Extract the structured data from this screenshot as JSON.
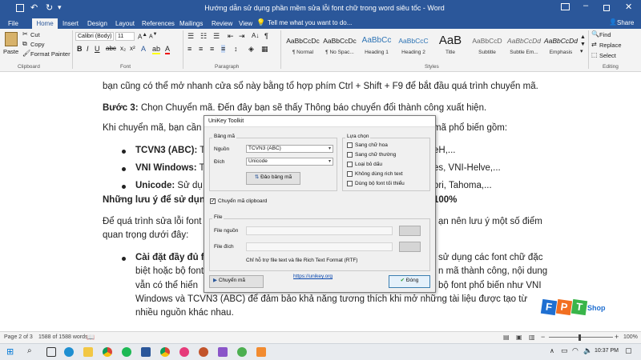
{
  "window": {
    "title": "Hướng dẫn sử dụng phần mềm sửa lỗi font chữ trong word siêu tốc - Word",
    "search_placeholder": "Tell me what you want to do..."
  },
  "tabs": [
    "File",
    "Home",
    "Insert",
    "Design",
    "Layout",
    "References",
    "Mailings",
    "Review",
    "View"
  ],
  "active_tab": "Home",
  "share_label": "Share",
  "ribbon": {
    "clipboard": {
      "paste": "Paste",
      "cut": "Cut",
      "copy": "Copy",
      "format_painter": "Format Painter",
      "label": "Clipboard"
    },
    "font": {
      "name": "Calibri (Body)",
      "size": "11",
      "label": "Font"
    },
    "paragraph_label": "Paragraph",
    "styles": [
      {
        "sample": "AaBbCcDc",
        "name": "¶ Normal"
      },
      {
        "sample": "AaBbCcDc",
        "name": "¶ No Spac..."
      },
      {
        "sample": "AaBbCc",
        "name": "Heading 1"
      },
      {
        "sample": "AaBbCcC",
        "name": "Heading 2"
      },
      {
        "sample": "AaB",
        "name": "Title"
      },
      {
        "sample": "AaBbCcD",
        "name": "Subtitle"
      },
      {
        "sample": "AaBbCcDd",
        "name": "Subtle Em..."
      },
      {
        "sample": "AaBbCcDd",
        "name": "Emphasis"
      }
    ],
    "styles_label": "Styles",
    "editing": {
      "find": "Find",
      "replace": "Replace",
      "select": "Select",
      "label": "Editing"
    }
  },
  "document": {
    "line_top": "bạn cũng có thể mở nhanh cửa sổ này bằng tổ hợp phím Ctrl + Shift + F9 để bắt đầu quá trình chuyển mã.",
    "step3_bold": "Bước 3:",
    "step3_text": " Chọn Chuyển mã. Đến đây bạn sẽ thấy Thông báo chuyển đổi thành công xuất hiện.",
    "para2_left": "Khi chuyển mã, bạn cần",
    "para2_right": "mã phổ biến gồm:",
    "bullets": [
      {
        "bold": "TCVN3 (ABC):",
        "left": " Th",
        "right": "eH,..."
      },
      {
        "bold": "VNI Windows:",
        "left": " T",
        "right": "es, VNI-Helve,..."
      },
      {
        "bold": "Unicode:",
        "left": " Sử dụ",
        "right": "ori, Tahoma,..."
      }
    ],
    "heading_left": "Những lưu ý để sử dụng",
    "heading_right": "100%",
    "para3_l1_left": "Để quá trình sửa lỗi font",
    "para3_l1_right": "ạn nên lưu ý một số điểm",
    "para3_l2": "quan trọng dưới đây:",
    "sub_bold_left": "Cài đặt đầy đủ f",
    "sub_lines": [
      {
        "left": "biệt hoặc bộ font",
        "right": "sử dụng các font chữ đặc"
      },
      {
        "left": "vẫn có thể hiển",
        "right": "n mã thành công, nội dung"
      },
      {
        "left": "",
        "right": "bộ font phổ biến như VNI"
      },
      {
        "left": "Windows và TCVN3 (ABC) để đảm bảo khả năng tương thích khi mở những tài liệu được tạo từ",
        "right": ""
      },
      {
        "left": "nhiều nguồn khác nhau.",
        "right": ""
      }
    ]
  },
  "status": {
    "page": "Page 2 of 3",
    "words": "1588 of 1588 words",
    "zoom": "100%"
  },
  "taskbar": {
    "time": "10:37 PM"
  },
  "watermark": {
    "brand_letters": "F P T",
    "shop": "Shop"
  },
  "dialog": {
    "title": "UniKey Toolkit",
    "bang_ma": "Bảng mã",
    "nguon_label": "Nguồn",
    "nguon_value": "TCVN3 (ABC)",
    "dich_label": "Đích",
    "dich_value": "Unicode",
    "swap_button": "Đảo bảng mã",
    "lua_chon": "Lựa chọn",
    "options": [
      "Sang chữ hoa",
      "Sang chữ thường",
      "Loại bỏ dấu",
      "Không dùng rich text",
      "Dùng bộ font tối thiểu"
    ],
    "clipboard_option": "Chuyển mã clipboard",
    "file_group": "File",
    "file_nguon": "File nguồn",
    "file_dich": "File đích",
    "note": "Chỉ hỗ trợ file text và file Rich Text Format (RTF)",
    "convert_button": "Chuyển mã",
    "link": "https://unikey.org",
    "close_button": "Đóng"
  },
  "colors": {
    "word_blue": "#2b579a",
    "fpt_blue": "#1f6fd1",
    "fpt_orange": "#f26f21",
    "fpt_green": "#39b54a"
  }
}
